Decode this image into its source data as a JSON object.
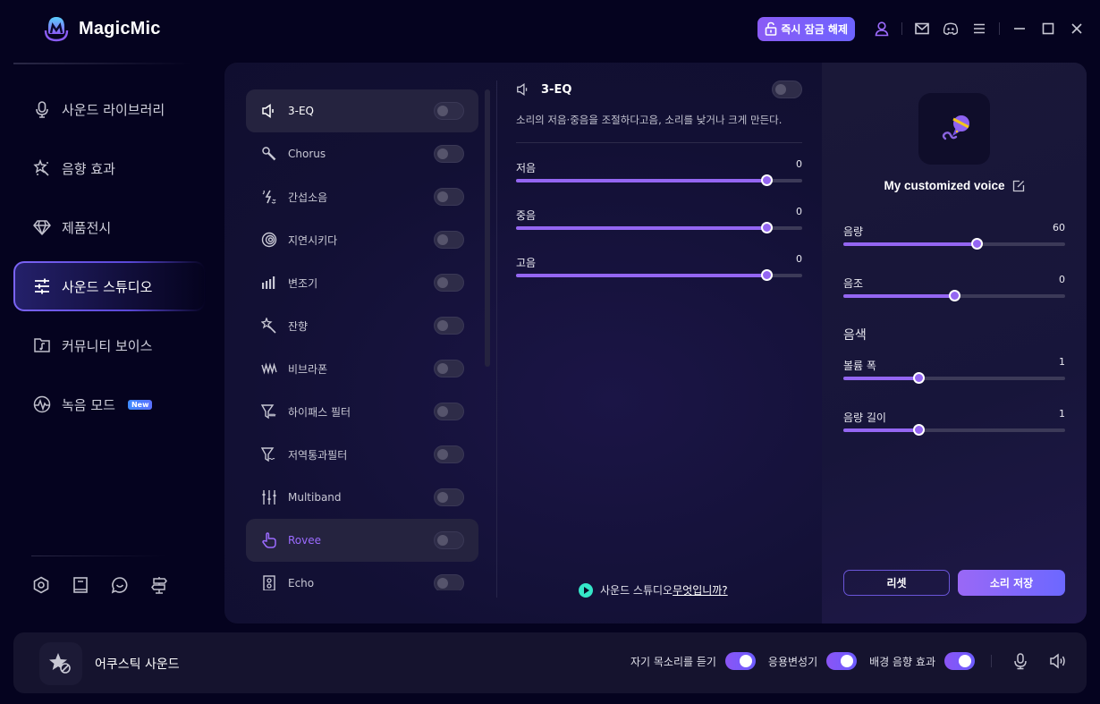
{
  "app": {
    "title": "MagicMic"
  },
  "topbar": {
    "unlock_label": "즉시 잠금 해제",
    "icons": [
      "lock-open-icon",
      "user-icon",
      "mail-icon",
      "discord-icon",
      "menu-icon",
      "minimize-icon",
      "maximize-icon",
      "close-icon"
    ]
  },
  "sidebar": {
    "items": [
      {
        "label": "사운드 라이브러리",
        "icon": "microphone-icon"
      },
      {
        "label": "음향 효과",
        "icon": "magic-wand-icon"
      },
      {
        "label": "제품전시",
        "icon": "diamond-icon"
      },
      {
        "label": "사운드 스튜디오",
        "icon": "sliders-icon",
        "active": true
      },
      {
        "label": "커뮤니티 보이스",
        "icon": "music-folder-icon"
      },
      {
        "label": "녹음 모드",
        "icon": "waveform-icon",
        "badge": "New"
      }
    ],
    "bottom_icons": [
      "settings-icon",
      "book-icon",
      "chat-icon",
      "signpost-icon"
    ]
  },
  "effects": [
    {
      "label": "3-EQ",
      "icon": "speaker-icon",
      "enabled": false,
      "selected": true
    },
    {
      "label": "Chorus",
      "icon": "microphone-small-icon",
      "enabled": false
    },
    {
      "label": "간섭소음",
      "icon": "lightning-noise-icon",
      "enabled": false
    },
    {
      "label": "지연시키다",
      "icon": "spiral-icon",
      "enabled": false
    },
    {
      "label": "변조기",
      "icon": "signal-bars-icon",
      "enabled": false
    },
    {
      "label": "잔향",
      "icon": "sparkle-wand-icon",
      "enabled": false
    },
    {
      "label": "비브라폰",
      "icon": "zigzag-wave-icon",
      "enabled": false
    },
    {
      "label": "하이패스 필터",
      "icon": "funnel-high-icon",
      "enabled": false
    },
    {
      "label": "저역통과필터",
      "icon": "funnel-low-icon",
      "enabled": false
    },
    {
      "label": "Multiband",
      "icon": "mixer-icon",
      "enabled": false
    },
    {
      "label": "Rovee",
      "icon": "hand-pointer-icon",
      "enabled": false,
      "hovered": true
    },
    {
      "label": "Echo",
      "icon": "loudspeaker-icon",
      "enabled": false
    }
  ],
  "detail": {
    "title": "3-EQ",
    "enabled": false,
    "description": "소리의 저음·중음을 조절하다고음, 소리를 낮거나 크게 만든다.",
    "sliders": [
      {
        "label": "저음",
        "value": "0",
        "fraction": 0.875
      },
      {
        "label": "중음",
        "value": "0",
        "fraction": 0.875
      },
      {
        "label": "고음",
        "value": "0",
        "fraction": 0.875
      }
    ],
    "help_prefix": "사운드 스튜디오 ",
    "help_link": "무엇입니까?"
  },
  "voice_panel": {
    "name": "My customized voice",
    "sliders": [
      {
        "label": "음량",
        "value": "60",
        "fraction": 0.6
      },
      {
        "label": "음조",
        "value": "0",
        "fraction": 0.5
      }
    ],
    "timbre_heading": "음색",
    "timbre_sliders": [
      {
        "label": "볼륨 폭",
        "value": "1",
        "fraction": 0.34
      },
      {
        "label": "음량 길이",
        "value": "1",
        "fraction": 0.34
      }
    ],
    "reset_label": "리셋",
    "save_label": "소리 저장"
  },
  "bottombar": {
    "current_voice": "어쿠스틱 사운드",
    "toggles": [
      {
        "label": "자기 목소리를 듣기",
        "on": true
      },
      {
        "label": "응용변성기",
        "on": true
      },
      {
        "label": "배경 음향 효과",
        "on": true
      }
    ]
  },
  "colors": {
    "accent": "#9466f2",
    "accent2": "#6c68ff",
    "background": "#05031f",
    "panel": "#121034",
    "teal": "#35e6c8"
  }
}
